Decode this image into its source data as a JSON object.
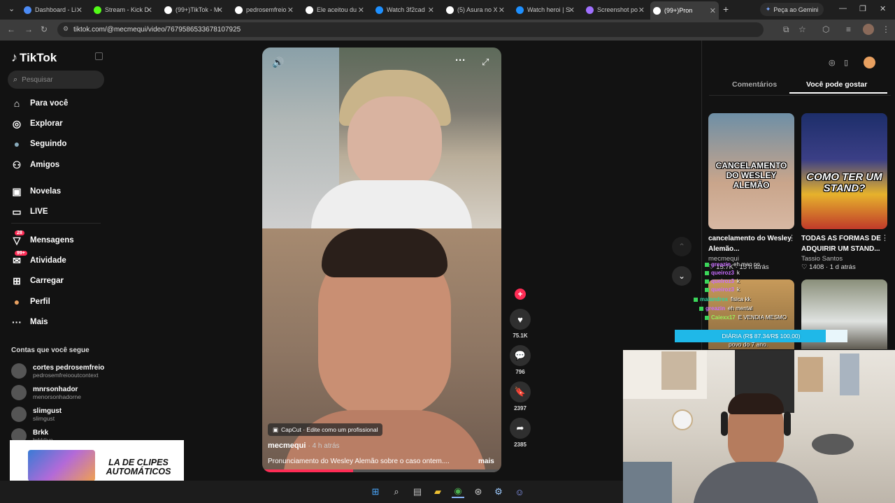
{
  "browser": {
    "tabs": [
      {
        "label": "Dashboard - Li",
        "color": "#4c8bf5"
      },
      {
        "label": "Stream - Kick D",
        "color": "#53fc18"
      },
      {
        "label": "(99+)TikTok - M",
        "color": "#ffffff"
      },
      {
        "label": "pedrosemfreio",
        "color": "#ffffff"
      },
      {
        "label": "Ele aceitou du",
        "color": "#ffffff"
      },
      {
        "label": "Watch 3f2cad",
        "color": "#1e90ff"
      },
      {
        "label": "(5) Asura no X",
        "color": "#ffffff"
      },
      {
        "label": "Watch heroi | S",
        "color": "#1e90ff"
      },
      {
        "label": "Screenshot po",
        "color": "#a070ff"
      },
      {
        "label": "(99+)Pron",
        "color": "#ffffff"
      }
    ],
    "gemini_label": "Peça ao Gemini",
    "url": "tiktok.com/@mecmequi/video/7679586533678107925"
  },
  "sidebar": {
    "logo": "TikTok",
    "search_placeholder": "Pesquisar",
    "nav": [
      {
        "label": "Para você",
        "icon": "home-icon"
      },
      {
        "label": "Explorar",
        "icon": "compass-icon"
      },
      {
        "label": "Seguindo",
        "icon": "following-icon"
      },
      {
        "label": "Amigos",
        "icon": "friends-icon"
      },
      {
        "label": "Novelas",
        "icon": "novelas-icon"
      },
      {
        "label": "LIVE",
        "icon": "live-icon"
      },
      {
        "label": "Mensagens",
        "icon": "messages-icon",
        "badge": "28"
      },
      {
        "label": "Atividade",
        "icon": "activity-icon",
        "badge": "99+"
      },
      {
        "label": "Carregar",
        "icon": "upload-icon"
      },
      {
        "label": "Perfil",
        "icon": "profile-icon"
      },
      {
        "label": "Mais",
        "icon": "more-icon"
      }
    ],
    "following_title": "Contas que você segue",
    "following": [
      {
        "name": "cortes pedrosemfreio",
        "user": "pedrosemfreiooutcontext"
      },
      {
        "name": "mnrsonhador",
        "user": "menorsonhadorne"
      },
      {
        "name": "slimgust",
        "user": "slimgust"
      },
      {
        "name": "Brkk",
        "user": "brkklive"
      }
    ]
  },
  "video": {
    "capcut": "CapCut · Edite como um profissional",
    "author": "mecmequi",
    "time": "· 4 h atrás",
    "caption": "Pronunciamento do Wesley Alemão sobre o caso ontem....",
    "more": "mais",
    "likes": "75.1K",
    "comments": "796",
    "saves": "2397",
    "shares": "2385"
  },
  "right_panel": {
    "tabs": [
      "Comentários",
      "Você pode gostar"
    ],
    "cards": [
      {
        "overlay": "CANCELAMENTO DO WESLEY ALEMÃO",
        "title": "cancelamento do Wesley Alemão...",
        "author": "mecmequi",
        "meta": "15.7K · 15 h atrás"
      },
      {
        "overlay": "COMO TER UM STAND?",
        "title": "TODAS AS FORMAS DE ADQUIRIR UM STAND...",
        "author": "Tassio Santos",
        "meta": "1408 · 1 d atrás"
      }
    ]
  },
  "overlay": {
    "chat": [
      {
        "user": "greazin",
        "msg": "eh mao po",
        "color": "#c86bff"
      },
      {
        "user": "queiroz3",
        "msg": "k",
        "color": "#c86bff"
      },
      {
        "user": "queiroz3",
        "msg": "k",
        "color": "#c86bff"
      },
      {
        "user": "queiroz3",
        "msg": "k",
        "color": "#c86bff"
      },
      {
        "user": "malandrex",
        "msg": "fisica kk",
        "color": "#2bd6a0"
      },
      {
        "user": "greazin",
        "msg": "eh mental",
        "color": "#c86bff"
      },
      {
        "user": "Caiexx17",
        "msg": "E VENDIA MESMO",
        "color": "#9aef5b"
      }
    ],
    "chat_partial": "povo do 7 ano.",
    "goal_text": "DIÁRIA (R$ 87.34/R$ 100,00)",
    "goal_progress": 0.8734,
    "promo_text": "LA DE CLIPES AUTOMÁTICOS"
  }
}
